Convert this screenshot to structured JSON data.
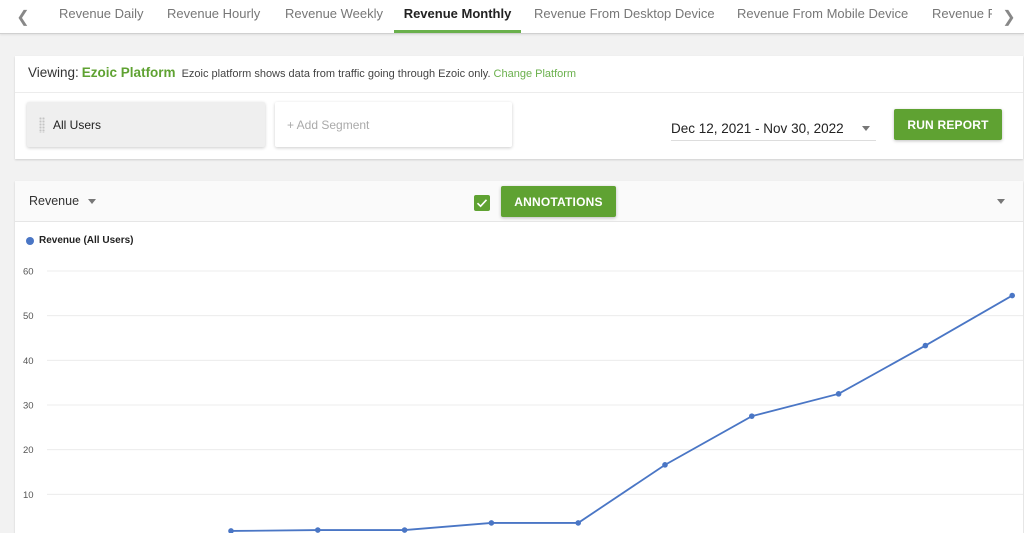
{
  "tabs": {
    "prev_icon": "chevron-left-icon",
    "next_icon": "chevron-right-icon",
    "items": [
      {
        "label": "Revenue Daily",
        "active": false
      },
      {
        "label": "Revenue Hourly",
        "active": false
      },
      {
        "label": "Revenue Weekly",
        "active": false
      },
      {
        "label": "Revenue Monthly",
        "active": true
      },
      {
        "label": "Revenue From Desktop Device",
        "active": false
      },
      {
        "label": "Revenue From Mobile Device",
        "active": false
      },
      {
        "label": "Revenue F",
        "active": false
      }
    ]
  },
  "viewing": {
    "label": "Viewing:",
    "platform": "Ezoic Platform",
    "description": "Ezoic platform shows data from traffic going through Ezoic only.",
    "change_link": "Change Platform"
  },
  "segments": {
    "active": "All Users",
    "add_placeholder": "+ Add Segment"
  },
  "date_range": {
    "value": "Dec 12, 2021 - Nov 30, 2022"
  },
  "buttons": {
    "run_report": "RUN REPORT",
    "annotations": "ANNOTATIONS"
  },
  "chart_controls": {
    "metric": "Revenue",
    "annotations_checked": true
  },
  "colors": {
    "accent_green": "#5fa232",
    "series_blue": "#4a76c5"
  },
  "chart_data": {
    "type": "line",
    "title": "",
    "xlabel": "",
    "ylabel": "",
    "ylim": [
      0,
      60
    ],
    "y_ticks": [
      10,
      20,
      30,
      40,
      50,
      60
    ],
    "grid": true,
    "legend": "top-left",
    "series": [
      {
        "name": "Revenue (All Users)",
        "color": "#4a76c5",
        "values": [
          1.8,
          2.0,
          2.0,
          3.6,
          3.6,
          16.6,
          27.5,
          32.5,
          43.3,
          54.5
        ]
      }
    ]
  }
}
